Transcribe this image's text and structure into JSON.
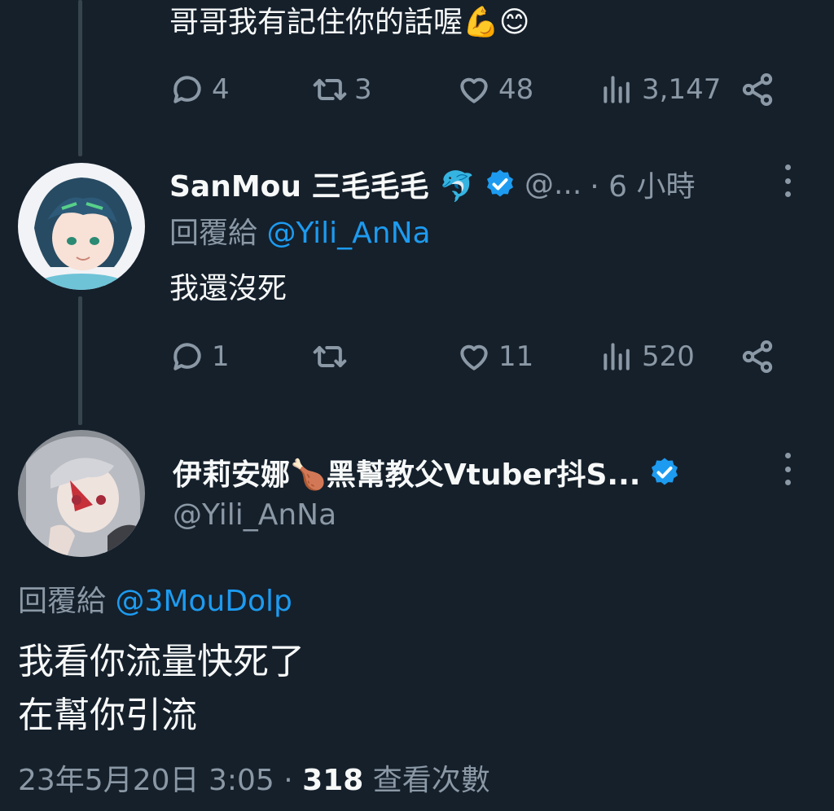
{
  "colors": {
    "background": "#15202b",
    "text": "#f7f9f9",
    "muted": "#8b98a5",
    "link": "#1d9bf0",
    "verified": "#1d9bf0"
  },
  "tweet1": {
    "text": "哥哥我有記住你的話喔💪😊",
    "replies": "4",
    "retweets": "3",
    "likes": "48",
    "views": "3,147"
  },
  "tweet2": {
    "name": "SanMou 三毛毛毛 🐬",
    "handle": "@...",
    "time": "· 6 小時",
    "reply_prefix": "回覆給 ",
    "reply_to": "@Yili_AnNa",
    "text": "我還沒死",
    "replies": "1",
    "retweets": "",
    "likes": "11",
    "views": "520"
  },
  "main_tweet": {
    "name": "伊莉安娜🍗黑幫教父Vtuber抖S...",
    "handle": "@Yili_AnNa",
    "reply_prefix": "回覆給 ",
    "reply_to": "@3MouDolp",
    "text_line1": "我看你流量快死了",
    "text_line2": "在幫你引流",
    "timestamp": "23年5月20日 3:05 · ",
    "view_count": "318",
    "view_label": " 查看次數"
  },
  "icons": {
    "reply": "reply-icon",
    "retweet": "retweet-icon",
    "like": "heart-icon",
    "views": "views-icon",
    "share": "share-icon",
    "more": "more-icon",
    "verified": "verified-badge-icon"
  }
}
